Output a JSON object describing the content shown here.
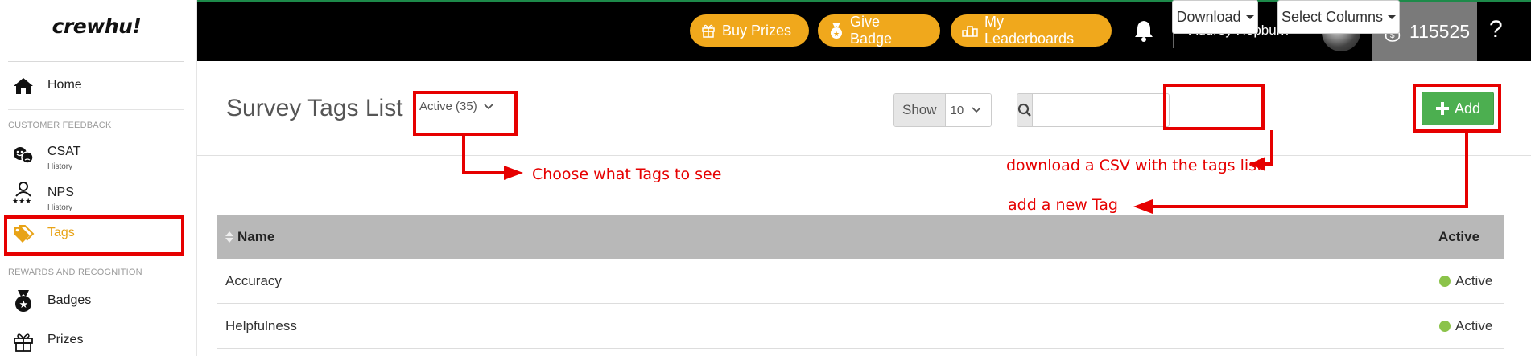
{
  "app": {
    "logo": "crewhu!"
  },
  "topbar": {
    "buy_prizes": "Buy Prizes",
    "give_badge": "Give Badge",
    "my_leaderboards": "My Leaderboards",
    "user_name": "Audrey Hepburn",
    "points": "115525",
    "help": "?"
  },
  "sidebar": {
    "home": "Home",
    "section_feedback": "CUSTOMER FEEDBACK",
    "csat": "CSAT",
    "csat_sub": "History",
    "nps": "NPS",
    "nps_sub": "History",
    "tags": "Tags",
    "section_rewards": "REWARDS AND RECOGNITION",
    "badges": "Badges",
    "prizes": "Prizes"
  },
  "main": {
    "title": "Survey Tags List",
    "status_filter": "Active (35)",
    "show_label": "Show",
    "show_value": "10",
    "search_placeholder": "",
    "download": "Download",
    "select_columns": "Select Columns",
    "add": "Add"
  },
  "annotations": {
    "choose_tags": "Choose what Tags to see",
    "download_csv": "download a CSV with the tags list",
    "add_tag": "add a new Tag"
  },
  "table": {
    "col_name": "Name",
    "col_active": "Active",
    "rows": [
      {
        "name": "Accuracy",
        "status": "Active"
      },
      {
        "name": "Helpfulness",
        "status": "Active"
      }
    ]
  },
  "colors": {
    "accent": "#f0a81c",
    "annotation": "#e60000",
    "add_button": "#4caf50",
    "active_dot": "#8bc34a"
  }
}
